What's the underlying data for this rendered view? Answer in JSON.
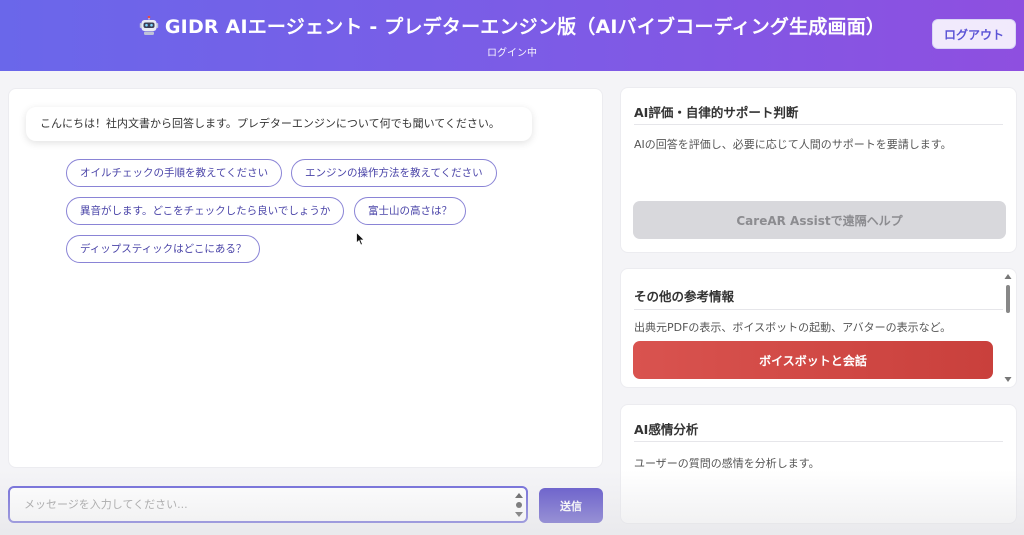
{
  "header": {
    "title": "GIDR AIエージェント - プレデターエンジン版（AIバイブコーディング生成画面）",
    "subtitle": "ログイン中",
    "logout_label": "ログアウト",
    "gradient_start": "#6a67ea",
    "gradient_end": "#8e4fe0"
  },
  "chat": {
    "bot_message": "こんにちは！社内文書から回答します。プレデターエンジンについて何でも聞いてください。",
    "suggestions": [
      "オイルチェックの手順を教えてください",
      "エンジンの操作方法を教えてください",
      "異音がします。どこをチェックしたら良いでしょうか",
      "富士山の高さは？",
      "ディップスティックはどこにある？"
    ]
  },
  "input": {
    "placeholder": "メッセージを入力してください...",
    "value": "",
    "send_label": "送信"
  },
  "cards": {
    "evaluation": {
      "title": "AI評価・自律的サポート判断",
      "description": "AIの回答を評価し、必要に応じて人間のサポートを要請します。",
      "button_label": "CareAR Assistで遠隔ヘルプ"
    },
    "reference": {
      "title": "その他の参考情報",
      "description": "出典元PDFの表示、ボイスボットの起動、アバターの表示など。",
      "button_label": "ボイスボットと会話"
    },
    "sentiment": {
      "title": "AI感情分析",
      "description": "ユーザーの質問の感情を分析します。"
    }
  },
  "colors": {
    "accent": "#5b4fc8",
    "danger": "#d9534f",
    "disabled": "#d8d8dc"
  }
}
